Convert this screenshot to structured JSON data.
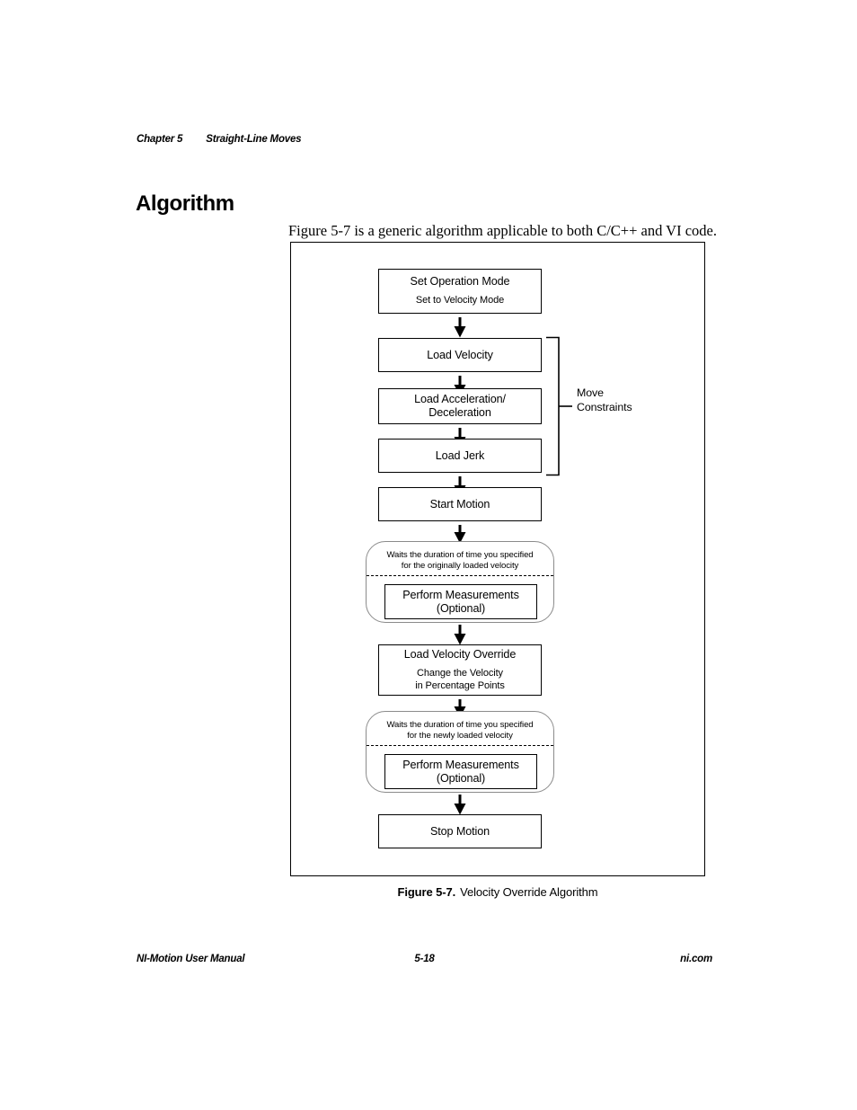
{
  "header": {
    "chapter": "Chapter 5",
    "section": "Straight-Line Moves"
  },
  "heading": "Algorithm",
  "paragraph": "Figure 5-7 is a generic algorithm applicable to both C/C++ and VI code.",
  "figure": {
    "caption_label": "Figure 5-7.",
    "caption_text": "Velocity Override Algorithm",
    "bracket_label_line1": "Move",
    "bracket_label_line2": "Constraints",
    "nodes": {
      "set_operation_mode": {
        "title": "Set Operation Mode",
        "sub1": "Set to Velocity Mode"
      },
      "load_velocity": {
        "title": "Load Velocity"
      },
      "load_accel_decel": {
        "title": "Load Acceleration/",
        "sub1": "Deceleration"
      },
      "load_jerk": {
        "title": "Load Jerk"
      },
      "start_motion": {
        "title": "Start Motion"
      },
      "wait_original": {
        "line1": "Waits the duration of time you specified",
        "line2": "for the originally loaded velocity"
      },
      "perform_measurements_1": {
        "title": "Perform Measurements",
        "sub1": "(Optional)"
      },
      "load_velocity_override": {
        "title": "Load Velocity Override",
        "sub1": "Change the Velocity",
        "sub2": "in Percentage Points"
      },
      "wait_newly": {
        "line1": "Waits the duration of time you specified",
        "line2": "for the newly loaded velocity"
      },
      "perform_measurements_2": {
        "title": "Perform Measurements",
        "sub1": "(Optional)"
      },
      "stop_motion": {
        "title": "Stop Motion"
      }
    }
  },
  "footer": {
    "manual": "NI-Motion User Manual",
    "page": "5-18",
    "site": "ni.com"
  },
  "colors": {
    "ink": "#000000",
    "shadow": "#221f20",
    "wait_border": "#8b8b8b"
  }
}
